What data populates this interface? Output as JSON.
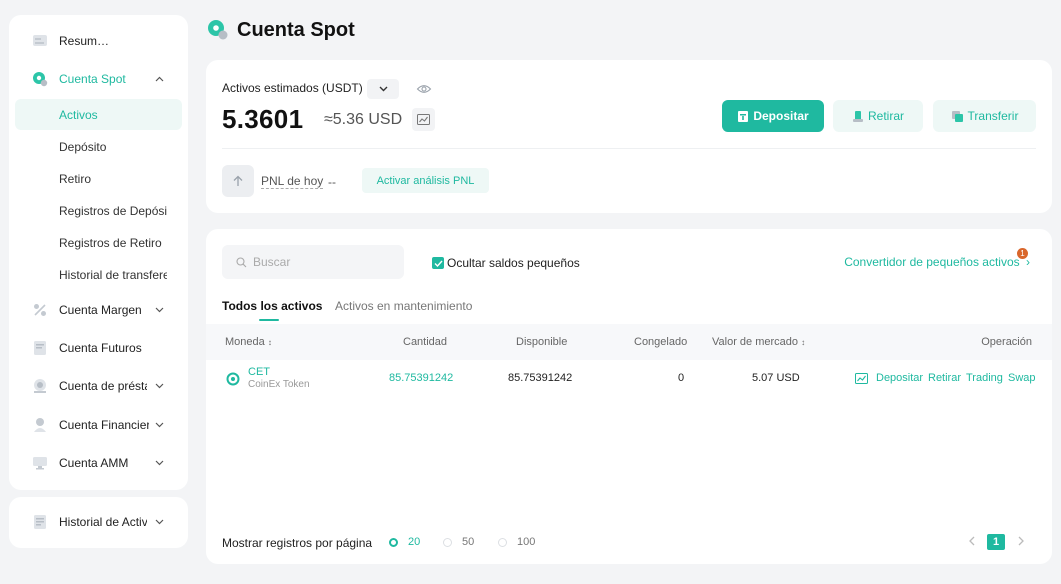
{
  "sidebar": {
    "items": [
      {
        "label": "Resumen de Activos",
        "icon": "summary-icon"
      },
      {
        "label": "Cuenta Spot",
        "icon": "spot-icon"
      },
      {
        "label": "Cuenta Margen",
        "icon": "margin-icon"
      },
      {
        "label": "Cuenta Futuros",
        "icon": "futures-icon"
      },
      {
        "label": "Cuenta de préstamo",
        "icon": "loan-icon"
      },
      {
        "label": "Cuenta Financiera",
        "icon": "finance-icon"
      },
      {
        "label": "Cuenta AMM",
        "icon": "amm-icon"
      }
    ],
    "spot_sub": [
      "Activos",
      "Depósito",
      "Retiro",
      "Registros de Depósito",
      "Registros de Retiro",
      "Historial de transferencias"
    ],
    "history": {
      "label": "Historial de Actividades"
    }
  },
  "header": {
    "title": "Cuenta Spot"
  },
  "balance": {
    "label": "Activos estimados (USDT)",
    "amount": "5.3601",
    "approx": "≈5.36 USD",
    "deposit_label": "Depositar",
    "withdraw_label": "Retirar",
    "transfer_label": "Transferir",
    "pnl_label": "PNL de hoy",
    "pnl_value": "--",
    "pnl_button": "Activar análisis PNL"
  },
  "assets": {
    "search_placeholder": "Buscar",
    "hide_small_label": "Ocultar saldos pequeños",
    "hide_small_checked": true,
    "converter_label": "Convertidor de pequeños activos",
    "converter_badge": "1",
    "tabs": [
      "Todos los activos",
      "Activos en mantenimiento"
    ],
    "columns": {
      "coin": "Moneda",
      "amount": "Cantidad",
      "available": "Disponible",
      "frozen": "Congelado",
      "market_value": "Valor de mercado",
      "operation": "Operación"
    },
    "rows": [
      {
        "code": "CET",
        "name": "CoinEx Token",
        "amount": "85.75391242",
        "available": "85.75391242",
        "frozen": "0",
        "market_value": "5.07 USD",
        "ops": [
          "Depositar",
          "Retirar",
          "Trading",
          "Swap"
        ]
      }
    ],
    "footer": {
      "label": "Mostrar registros por página",
      "page_sizes": [
        "20",
        "50",
        "100"
      ],
      "selected_size": "20",
      "current_page": "1"
    }
  },
  "colors": {
    "accent": "#1fb9a0",
    "badge": "#d9662b"
  }
}
